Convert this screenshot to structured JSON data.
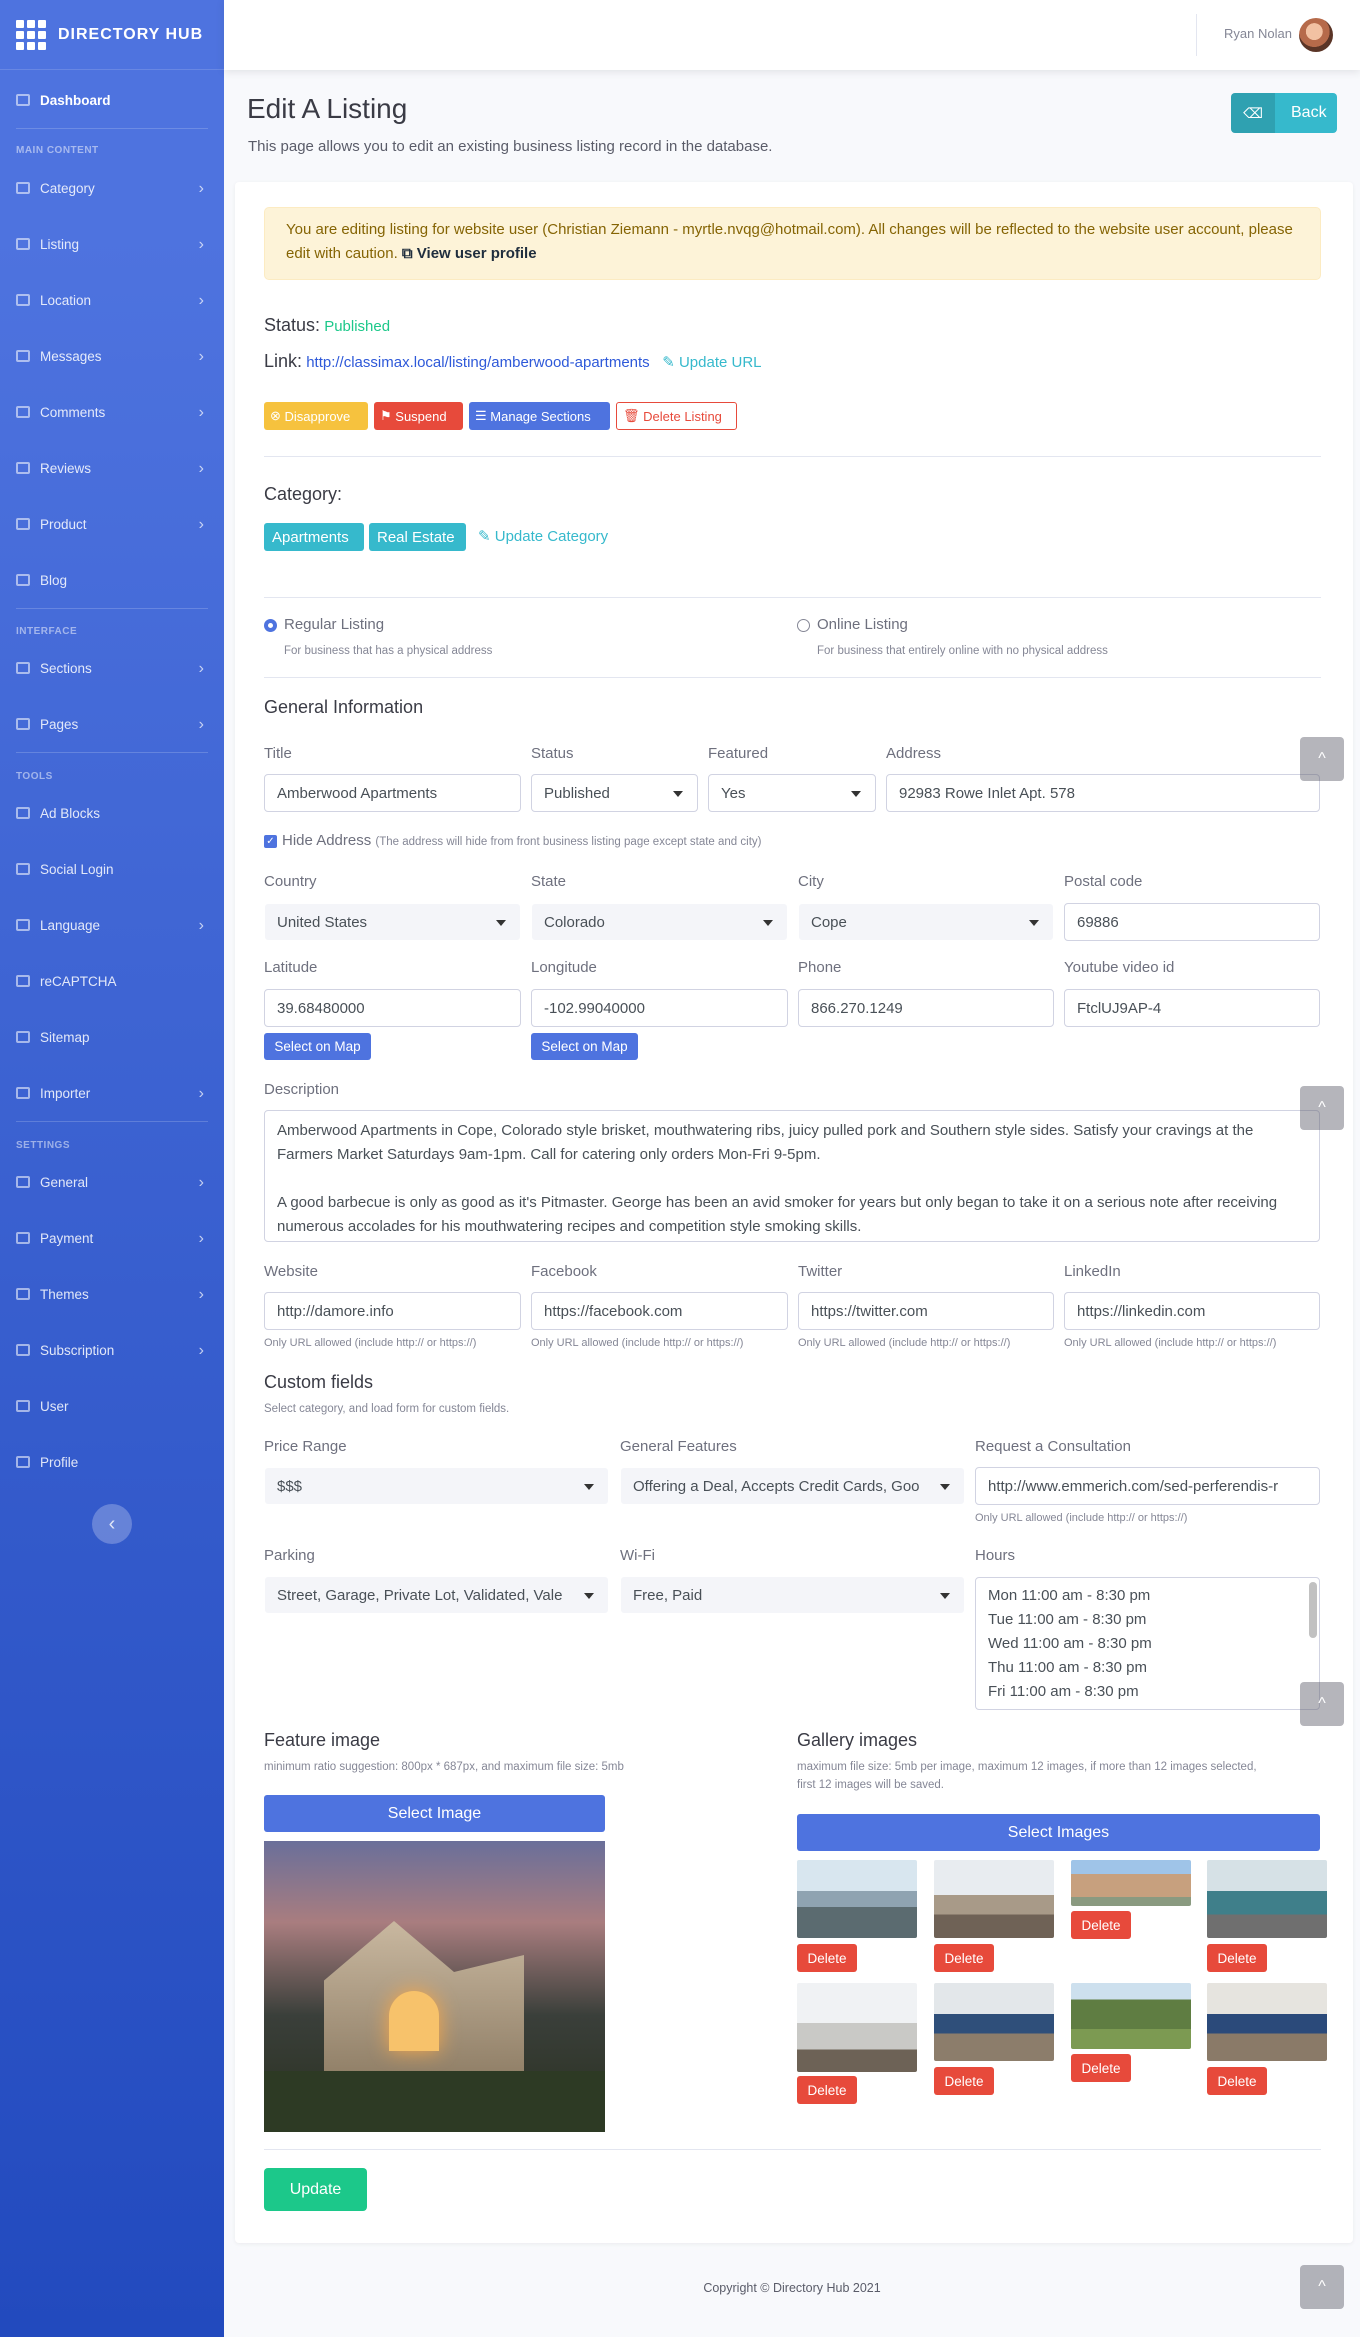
{
  "brand": "DIRECTORY HUB",
  "sidebar": {
    "dashboard": "Dashboard",
    "heading_main": "MAIN CONTENT",
    "category": "Category",
    "listing": "Listing",
    "location": "Location",
    "messages": "Messages",
    "comments": "Comments",
    "reviews": "Reviews",
    "product": "Product",
    "blog": "Blog",
    "heading_interface": "INTERFACE",
    "sections": "Sections",
    "pages": "Pages",
    "heading_tools": "TOOLS",
    "ad_blocks": "Ad Blocks",
    "social_login": "Social Login",
    "language": "Language",
    "recaptcha": "reCAPTCHA",
    "sitemap": "Sitemap",
    "importer": "Importer",
    "heading_settings": "SETTINGS",
    "general": "General",
    "payment": "Payment",
    "themes": "Themes",
    "subscription": "Subscription",
    "user": "User",
    "profile": "Profile"
  },
  "topbar": {
    "user_name": "Ryan Nolan"
  },
  "page": {
    "title": "Edit A Listing",
    "subtitle": "This page allows you to edit an existing business listing record in the database.",
    "back_label": "Back"
  },
  "alert": {
    "text": "You are editing listing for website user (Christian Ziemann - myrtle.nvqg@hotmail.com). All changes will be reflected to the website user account, please edit with caution.",
    "link": "View user profile"
  },
  "status": {
    "label": "Status:",
    "value": "Published"
  },
  "link": {
    "label": "Link:",
    "url": "http://classimax.local/listing/amberwood-apartments",
    "update": "Update URL"
  },
  "actions": {
    "disapprove": "Disapprove",
    "suspend": "Suspend",
    "manage_sections": "Manage Sections",
    "delete_listing": "Delete Listing"
  },
  "category": {
    "label": "Category:",
    "tags": [
      "Apartments",
      "Real Estate"
    ],
    "update": "Update Category"
  },
  "listing_type": {
    "regular": "Regular Listing",
    "regular_help": "For business that has a physical address",
    "online": "Online Listing",
    "online_help": "For business that entirely online with no physical address"
  },
  "general": {
    "heading": "General Information",
    "title_label": "Title",
    "title_value": "Amberwood Apartments",
    "status_label": "Status",
    "status_value": "Published",
    "featured_label": "Featured",
    "featured_value": "Yes",
    "address_label": "Address",
    "address_value": "92983 Rowe Inlet Apt. 578",
    "hide_address": "Hide Address",
    "hide_address_help": "(The address will hide from front business listing page except state and city)",
    "country_label": "Country",
    "country_value": "United States",
    "state_label": "State",
    "state_value": "Colorado",
    "city_label": "City",
    "city_value": "Cope",
    "postal_label": "Postal code",
    "postal_value": "69886",
    "lat_label": "Latitude",
    "lat_value": "39.68480000",
    "lng_label": "Longitude",
    "lng_value": "-102.99040000",
    "phone_label": "Phone",
    "phone_value": "866.270.1249",
    "youtube_label": "Youtube video id",
    "youtube_value": "FtclUJ9AP-4",
    "select_on_map": "Select on Map",
    "description_label": "Description",
    "description_p1": "Amberwood Apartments in Cope, Colorado style brisket, mouthwatering ribs, juicy pulled pork and Southern style sides. Satisfy your cravings at the Farmers Market Saturdays 9am-1pm. Call for catering only orders Mon-Fri 9-5pm.",
    "description_p2": "A good barbecue is only as good as it's Pitmaster. George has been an avid smoker for years but only began to take it on a serious note after receiving numerous accolades for his mouthwatering recipes and competition style smoking skills.",
    "website_label": "Website",
    "website_value": "http://damore.info",
    "facebook_label": "Facebook",
    "facebook_value": "https://facebook.com",
    "twitter_label": "Twitter",
    "twitter_value": "https://twitter.com",
    "linkedin_label": "LinkedIn",
    "linkedin_value": "https://linkedin.com",
    "url_help": "Only URL allowed (include http:// or https://)"
  },
  "custom": {
    "heading": "Custom fields",
    "help": "Select category, and load form for custom fields.",
    "price_label": "Price Range",
    "price_value": "$$$",
    "features_label": "General Features",
    "features_value": "Offering a Deal, Accepts Credit Cards, Goo",
    "consult_label": "Request a Consultation",
    "consult_value": "http://www.emmerich.com/sed-perferendis-r",
    "consult_help": "Only URL allowed (include http:// or https://)",
    "parking_label": "Parking",
    "parking_value": "Street, Garage, Private Lot, Validated, Vale",
    "wifi_label": "Wi-Fi",
    "wifi_value": "Free, Paid",
    "hours_label": "Hours",
    "hours": [
      "Mon 11:00 am - 8:30 pm",
      "Tue 11:00 am - 8:30 pm",
      "Wed 11:00 am - 8:30 pm",
      "Thu 11:00 am - 8:30 pm",
      "Fri 11:00 am - 8:30 pm"
    ]
  },
  "feature_image": {
    "heading": "Feature image",
    "help": "minimum ratio suggestion: 800px * 687px, and maximum file size: 5mb",
    "button": "Select Image"
  },
  "gallery": {
    "heading": "Gallery images",
    "help1": "maximum file size: 5mb per image, maximum 12 images, if more than 12 images selected,",
    "help2": "first 12 images will be saved.",
    "button": "Select Images",
    "delete": "Delete"
  },
  "update_label": "Update",
  "footer": "Copyright © Directory Hub 2021",
  "colors": {
    "primary": "#4e73df",
    "success": "#1cc88a",
    "info": "#36b9cc",
    "warning": "#f6c23e",
    "danger": "#e74a3b"
  }
}
